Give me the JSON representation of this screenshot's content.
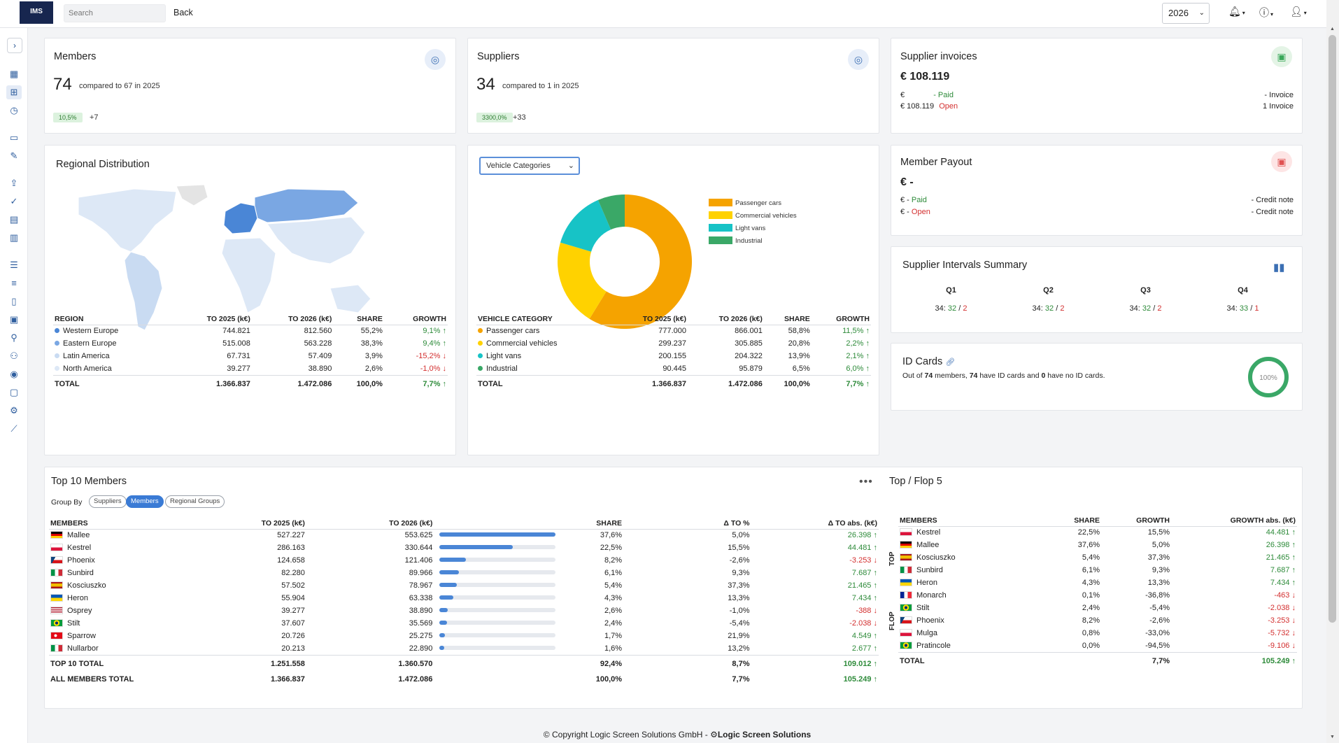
{
  "topbar": {
    "logo": "IMS",
    "search_placeholder": "Search",
    "back_label": "Back",
    "year": "2026"
  },
  "members_card": {
    "title": "Members",
    "value": "74",
    "compare": "compared to 67 in 2025",
    "pct": "10,5%",
    "delta": "+7"
  },
  "suppliers_card": {
    "title": "Suppliers",
    "value": "34",
    "compare": "compared to 1 in 2025",
    "pct": "3300,0%",
    "delta": "+33"
  },
  "supplier_invoices": {
    "title": "Supplier invoices",
    "value": "€ 108.119",
    "line1_amount": "€",
    "line1_sep": "-",
    "line1_status": "Paid",
    "line1_right": "- Invoice",
    "line2_amount": "€ 108.119",
    "line2_status": "Open",
    "line2_right": "1 Invoice"
  },
  "member_payout": {
    "title": "Member Payout",
    "value": "€ -",
    "line1_amount": "€ -",
    "line1_status": "Paid",
    "line1_right": "- Credit note",
    "line2_amount": "€ -",
    "line2_status": "Open",
    "line2_right": "- Credit note"
  },
  "intervals": {
    "title": "Supplier Intervals Summary",
    "quarters": [
      {
        "label": "Q1",
        "total": "34:",
        "a": "32",
        "sep": "/",
        "b": "2"
      },
      {
        "label": "Q2",
        "total": "34:",
        "a": "32",
        "sep": "/",
        "b": "2"
      },
      {
        "label": "Q3",
        "total": "34:",
        "a": "32",
        "sep": "/",
        "b": "2"
      },
      {
        "label": "Q4",
        "total": "34:",
        "a": "33",
        "sep": "/",
        "b": "1"
      }
    ]
  },
  "id_cards": {
    "title": "ID Cards",
    "t1": "Out of ",
    "n1": "74",
    "t2": " members, ",
    "n2": "74",
    "t3": " have ID cards and ",
    "n3": "0",
    "t4": " have no ID cards.",
    "ring_label": "100%",
    "ring_value": 100
  },
  "regional": {
    "title": "Regional Distribution",
    "headers": [
      "REGION",
      "TO 2025 (k€)",
      "TO 2026 (k€)",
      "SHARE",
      "GROWTH"
    ],
    "rows": [
      {
        "name": "Western Europe",
        "color": "#4a86d6",
        "v25": "744.821",
        "v26": "812.560",
        "share": "55,2%",
        "growth": "9,1%",
        "dir": "up"
      },
      {
        "name": "Eastern Europe",
        "color": "#7aa7e3",
        "v25": "515.008",
        "v26": "563.228",
        "share": "38,3%",
        "growth": "9,4%",
        "dir": "up"
      },
      {
        "name": "Latin America",
        "color": "#c9dbf2",
        "v25": "67.731",
        "v26": "57.409",
        "share": "3,9%",
        "growth": "-15,2%",
        "dir": "down"
      },
      {
        "name": "North America",
        "color": "#dde8f6",
        "v25": "39.277",
        "v26": "38.890",
        "share": "2,6%",
        "growth": "-1,0%",
        "dir": "down"
      }
    ],
    "total": {
      "name": "TOTAL",
      "v25": "1.366.837",
      "v26": "1.472.086",
      "share": "100,0%",
      "growth": "7,7%"
    }
  },
  "vehicle": {
    "select_label": "Vehicle Categories",
    "headers": [
      "VEHICLE CATEGORY",
      "TO 2025 (k€)",
      "TO 2026 (k€)",
      "SHARE",
      "GROWTH"
    ],
    "rows": [
      {
        "name": "Passenger cars",
        "color": "#f5a300",
        "v25": "777.000",
        "v26": "866.001",
        "share": "58,8%",
        "growth": "11,5%",
        "dir": "up"
      },
      {
        "name": "Commercial vehicles",
        "color": "#ffd200",
        "v25": "299.237",
        "v26": "305.885",
        "share": "20,8%",
        "growth": "2,2%",
        "dir": "up"
      },
      {
        "name": "Light vans",
        "color": "#17c3c6",
        "v25": "200.155",
        "v26": "204.322",
        "share": "13,9%",
        "growth": "2,1%",
        "dir": "up"
      },
      {
        "name": "Industrial",
        "color": "#3aa867",
        "v25": "90.445",
        "v26": "95.879",
        "share": "6,5%",
        "growth": "6,0%",
        "dir": "up"
      }
    ],
    "total": {
      "name": "TOTAL",
      "v25": "1.366.837",
      "v26": "1.472.086",
      "share": "100,0%",
      "growth": "7,7%"
    }
  },
  "chart_data": {
    "type": "pie",
    "categories": [
      "Passenger cars",
      "Commercial vehicles",
      "Light vans",
      "Industrial"
    ],
    "values": [
      58.8,
      20.8,
      13.9,
      6.5
    ],
    "colors": [
      "#f5a300",
      "#ffd200",
      "#17c3c6",
      "#3aa867"
    ],
    "title": "",
    "legend": "right"
  },
  "top10": {
    "title": "Top 10 Members",
    "group_by": "Group By",
    "groups": [
      "Suppliers",
      "Members",
      "Regional Groups"
    ],
    "active_group": 1,
    "headers": [
      "MEMBERS",
      "TO 2025 (k€)",
      "TO 2026 (k€)",
      "SHARE",
      "Δ TO %",
      "Δ TO abs. (k€)"
    ],
    "rows": [
      {
        "name": "Mallee",
        "flag": "de",
        "v25": "527.227",
        "v26": "553.625",
        "share": "37,6%",
        "bar": 37.6,
        "dpct": "5,0%",
        "dabs": "26.398",
        "dir": "up"
      },
      {
        "name": "Kestrel",
        "flag": "pl",
        "v25": "286.163",
        "v26": "330.644",
        "share": "22,5%",
        "bar": 22.5,
        "dpct": "15,5%",
        "dabs": "44.481",
        "dir": "up"
      },
      {
        "name": "Phoenix",
        "flag": "cz",
        "v25": "124.658",
        "v26": "121.406",
        "share": "8,2%",
        "bar": 8.2,
        "dpct": "-2,6%",
        "dabs": "-3.253",
        "dir": "down"
      },
      {
        "name": "Sunbird",
        "flag": "it",
        "v25": "82.280",
        "v26": "89.966",
        "share": "6,1%",
        "bar": 6.1,
        "dpct": "9,3%",
        "dabs": "7.687",
        "dir": "up"
      },
      {
        "name": "Kosciuszko",
        "flag": "es",
        "v25": "57.502",
        "v26": "78.967",
        "share": "5,4%",
        "bar": 5.4,
        "dpct": "37,3%",
        "dabs": "21.465",
        "dir": "up"
      },
      {
        "name": "Heron",
        "flag": "ua",
        "v25": "55.904",
        "v26": "63.338",
        "share": "4,3%",
        "bar": 4.3,
        "dpct": "13,3%",
        "dabs": "7.434",
        "dir": "up"
      },
      {
        "name": "Osprey",
        "flag": "us",
        "v25": "39.277",
        "v26": "38.890",
        "share": "2,6%",
        "bar": 2.6,
        "dpct": "-1,0%",
        "dabs": "-388",
        "dir": "down"
      },
      {
        "name": "Stilt",
        "flag": "br",
        "v25": "37.607",
        "v26": "35.569",
        "share": "2,4%",
        "bar": 2.4,
        "dpct": "-5,4%",
        "dabs": "-2.038",
        "dir": "down"
      },
      {
        "name": "Sparrow",
        "flag": "tr",
        "v25": "20.726",
        "v26": "25.275",
        "share": "1,7%",
        "bar": 1.7,
        "dpct": "21,9%",
        "dabs": "4.549",
        "dir": "up"
      },
      {
        "name": "Nullarbor",
        "flag": "it",
        "v25": "20.213",
        "v26": "22.890",
        "share": "1,6%",
        "bar": 1.6,
        "dpct": "13,2%",
        "dabs": "2.677",
        "dir": "up"
      }
    ],
    "totals": [
      {
        "name": "TOP 10 TOTAL",
        "v25": "1.251.558",
        "v26": "1.360.570",
        "share": "92,4%",
        "dpct": "8,7%",
        "dabs": "109.012"
      },
      {
        "name": "ALL MEMBERS TOTAL",
        "v25": "1.366.837",
        "v26": "1.472.086",
        "share": "100,0%",
        "dpct": "7,7%",
        "dabs": "105.249"
      }
    ]
  },
  "topflop": {
    "title": "Top / Flop 5",
    "top_label": "TOP",
    "flop_label": "FLOP",
    "headers": [
      "MEMBERS",
      "SHARE",
      "GROWTH",
      "GROWTH abs. (k€)"
    ],
    "rows": [
      {
        "name": "Kestrel",
        "flag": "pl",
        "share": "22,5%",
        "growth": "15,5%",
        "abs": "44.481",
        "dir": "up"
      },
      {
        "name": "Mallee",
        "flag": "de",
        "share": "37,6%",
        "growth": "5,0%",
        "abs": "26.398",
        "dir": "up"
      },
      {
        "name": "Kosciuszko",
        "flag": "es",
        "share": "5,4%",
        "growth": "37,3%",
        "abs": "21.465",
        "dir": "up"
      },
      {
        "name": "Sunbird",
        "flag": "it",
        "share": "6,1%",
        "growth": "9,3%",
        "abs": "7.687",
        "dir": "up"
      },
      {
        "name": "Heron",
        "flag": "ua",
        "share": "4,3%",
        "growth": "13,3%",
        "abs": "7.434",
        "dir": "up"
      },
      {
        "name": "Monarch",
        "flag": "fr",
        "share": "0,1%",
        "growth": "-36,8%",
        "abs": "-463",
        "dir": "down"
      },
      {
        "name": "Stilt",
        "flag": "br",
        "share": "2,4%",
        "growth": "-5,4%",
        "abs": "-2.038",
        "dir": "down"
      },
      {
        "name": "Phoenix",
        "flag": "cz",
        "share": "8,2%",
        "growth": "-2,6%",
        "abs": "-3.253",
        "dir": "down"
      },
      {
        "name": "Mulga",
        "flag": "pl",
        "share": "0,8%",
        "growth": "-33,0%",
        "abs": "-5.732",
        "dir": "down"
      },
      {
        "name": "Pratincole",
        "flag": "br",
        "share": "0,0%",
        "growth": "-94,5%",
        "abs": "-9.106",
        "dir": "down"
      }
    ],
    "total": {
      "name": "TOTAL",
      "growth": "7,7%",
      "abs": "105.249"
    }
  },
  "footer": {
    "text": "© Copyright Logic Screen Solutions GmbH - ",
    "brand_a": "Logic Screen",
    "brand_b": " Solutions"
  },
  "icons": [
    "chevron-right-icon",
    "apps-icon",
    "dashboard-icon",
    "clock-icon",
    "folder-icon",
    "edit-icon",
    "upload-icon",
    "check-icon",
    "document-icon",
    "calc-icon",
    "list-icon",
    "list-alt-icon",
    "receipt-icon",
    "calendar-icon",
    "user-icon",
    "users-icon",
    "account-circle-icon",
    "id-card-icon",
    "gear-icon",
    "chart-line-icon"
  ],
  "colors": {
    "accent": "#3a7bd5",
    "positive": "#2e8b3a",
    "negative": "#d32f2f",
    "pill_bg": "#dcf2de"
  }
}
